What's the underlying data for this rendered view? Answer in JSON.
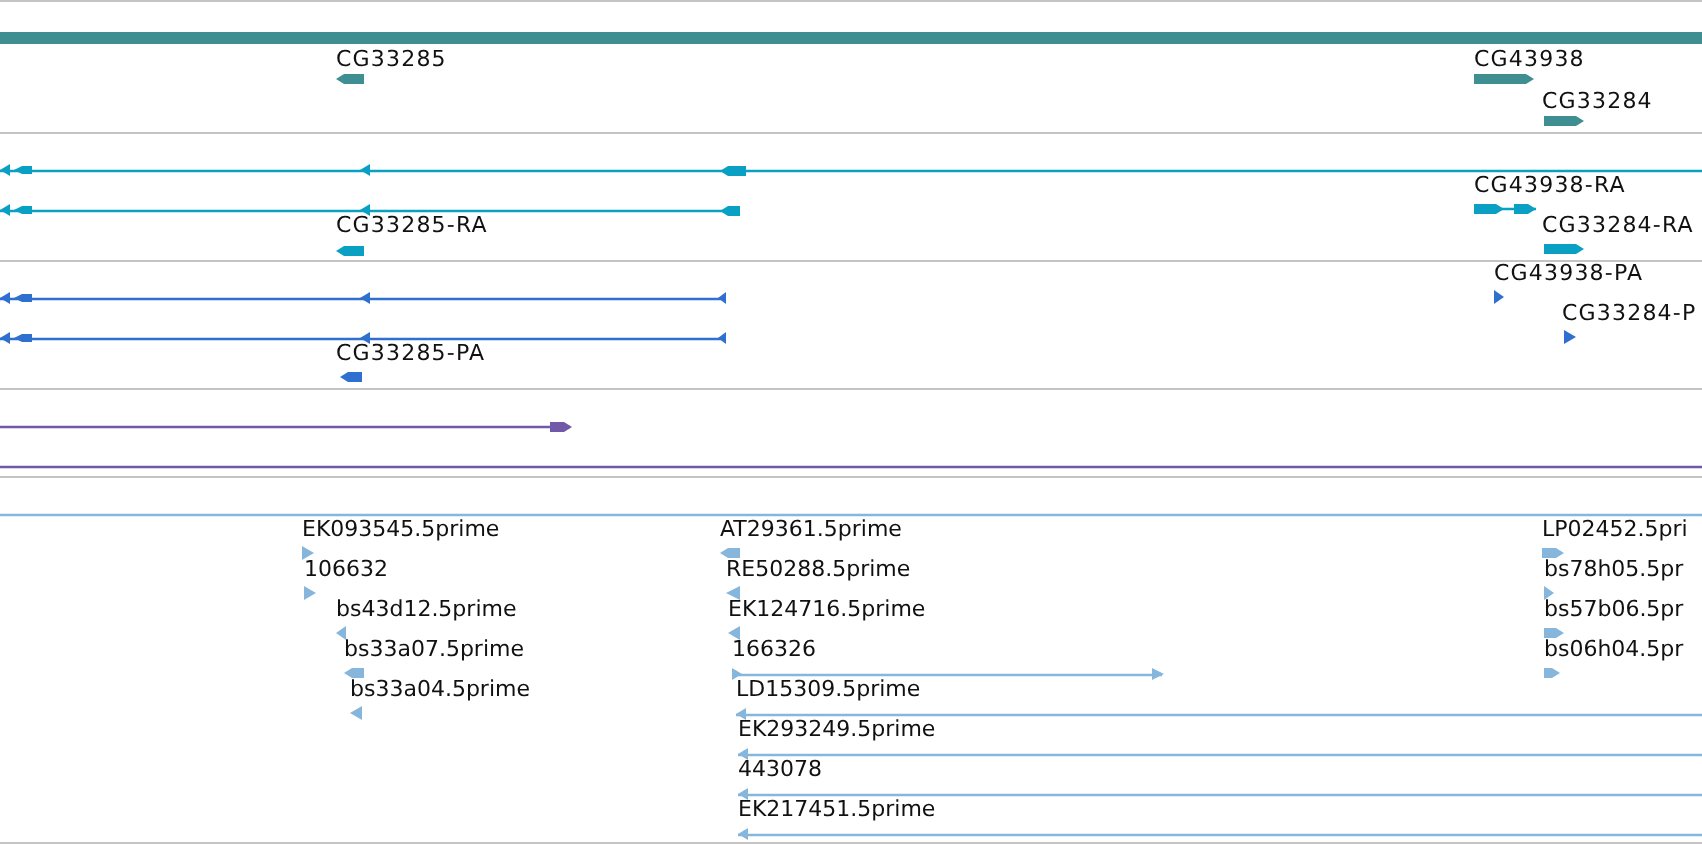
{
  "tracks": [
    {
      "kind": "gene",
      "color": "#3f8f92",
      "features": [
        {
          "kind": "span"
        },
        {
          "kind": "feature",
          "label": "CG33285",
          "reverse": true
        },
        {
          "kind": "feature",
          "label": "CG43938",
          "reverse": false
        },
        {
          "kind": "feature",
          "label": "CG33284",
          "reverse": false
        }
      ]
    },
    {
      "kind": "transcript",
      "color": "#0aa0c4",
      "features": [
        {
          "kind": "feature",
          "reverse": true
        },
        {
          "kind": "feature",
          "reverse": true
        },
        {
          "kind": "feature",
          "label": "CG33285-RA",
          "reverse": true
        },
        {
          "kind": "feature",
          "label": "CG43938-RA",
          "reverse": false
        },
        {
          "kind": "feature",
          "label": "CG33284-RA",
          "reverse": false
        }
      ]
    },
    {
      "kind": "protein",
      "color": "#2f6fd0",
      "features": [
        {
          "kind": "feature",
          "reverse": true
        },
        {
          "kind": "feature",
          "reverse": true
        },
        {
          "kind": "feature",
          "label": "CG33285-PA",
          "reverse": true
        },
        {
          "kind": "feature",
          "label": "CG43938-PA",
          "reverse": false
        },
        {
          "kind": "feature",
          "label": "CG33284-P",
          "reverse": false
        }
      ]
    },
    {
      "kind": "ncrna",
      "color": "#7158a8",
      "features": [
        {
          "kind": "feature",
          "reverse": false
        },
        {
          "kind": "span"
        }
      ]
    },
    {
      "kind": "est",
      "color": "#86b6dc",
      "features": [
        {
          "kind": "span"
        },
        {
          "kind": "feature",
          "label": "EK093545.5prime",
          "reverse": false
        },
        {
          "kind": "feature",
          "label": "106632",
          "reverse": false
        },
        {
          "kind": "feature",
          "label": "bs43d12.5prime",
          "reverse": true
        },
        {
          "kind": "feature",
          "label": "bs33a07.5prime",
          "reverse": true
        },
        {
          "kind": "feature",
          "label": "bs33a04.5prime",
          "reverse": true
        },
        {
          "kind": "feature",
          "label": "AT29361.5prime",
          "reverse": true
        },
        {
          "kind": "feature",
          "label": "RE50288.5prime",
          "reverse": true
        },
        {
          "kind": "feature",
          "label": "EK124716.5prime",
          "reverse": true
        },
        {
          "kind": "feature",
          "label": "166326",
          "reverse": false
        },
        {
          "kind": "feature",
          "label": "LD15309.5prime",
          "reverse": true
        },
        {
          "kind": "feature",
          "label": "EK293249.5prime",
          "reverse": true
        },
        {
          "kind": "feature",
          "label": "443078",
          "reverse": true
        },
        {
          "kind": "feature",
          "label": "EK217451.5prime",
          "reverse": true
        },
        {
          "kind": "feature",
          "label": "LP02452.5pri",
          "reverse": false
        },
        {
          "kind": "feature",
          "label": "bs78h05.5pr",
          "reverse": false
        },
        {
          "kind": "feature",
          "label": "bs57b06.5pr",
          "reverse": false
        },
        {
          "kind": "feature",
          "label": "bs06h04.5pr",
          "reverse": false
        }
      ]
    }
  ]
}
